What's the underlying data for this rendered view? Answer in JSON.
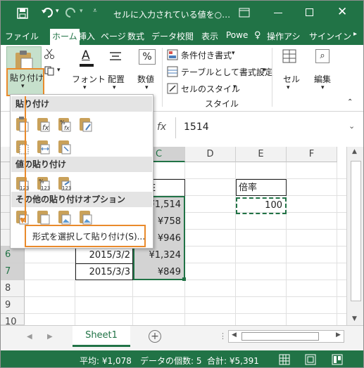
{
  "title_bar": {
    "title": "セルに入力されている値を○…",
    "help_glyph": "?",
    "colors": {
      "excel_green": "#217346"
    }
  },
  "tabs": [
    "ファイル",
    "ホーム",
    "挿入",
    "ページ",
    "数式",
    "データ",
    "校閲",
    "表示",
    "Powe",
    "操作アシ",
    "サインイン"
  ],
  "ribbon": {
    "paste_label": "貼り付け",
    "font_label": "フォント",
    "align_label": "配置",
    "number_label": "数値",
    "cond_format": "条件付き書式",
    "table_format": "テーブルとして書式設定",
    "cell_styles": "セルのスタイル",
    "styles_group": "スタイル",
    "cells_label": "セル",
    "edit_label": "編集"
  },
  "formula_bar": {
    "fx": "fx",
    "value": "1514"
  },
  "columns": [
    "C",
    "D",
    "E",
    "F"
  ],
  "rows": [
    "6",
    "7",
    "8",
    "9",
    "10"
  ],
  "cells": {
    "c_values": [
      "¥1,514",
      "¥758",
      "¥946",
      "¥1,324",
      "¥849"
    ],
    "b_dates": [
      "2015/3/2",
      "2015/3/3"
    ],
    "e_header": "倍率",
    "e_value": "100",
    "c_header_partial": "E"
  },
  "paste_menu": {
    "section_paste": "貼り付け",
    "section_values": "値の貼り付け",
    "section_other": "その他の貼り付けオプション",
    "special": "形式を選択して貼り付け(S)..."
  },
  "sheet_tabs": {
    "sheet1": "Sheet1"
  },
  "status": {
    "average": "平均: ¥1,078",
    "count": "データの個数: 5",
    "sum": "合計: ¥5,391"
  }
}
